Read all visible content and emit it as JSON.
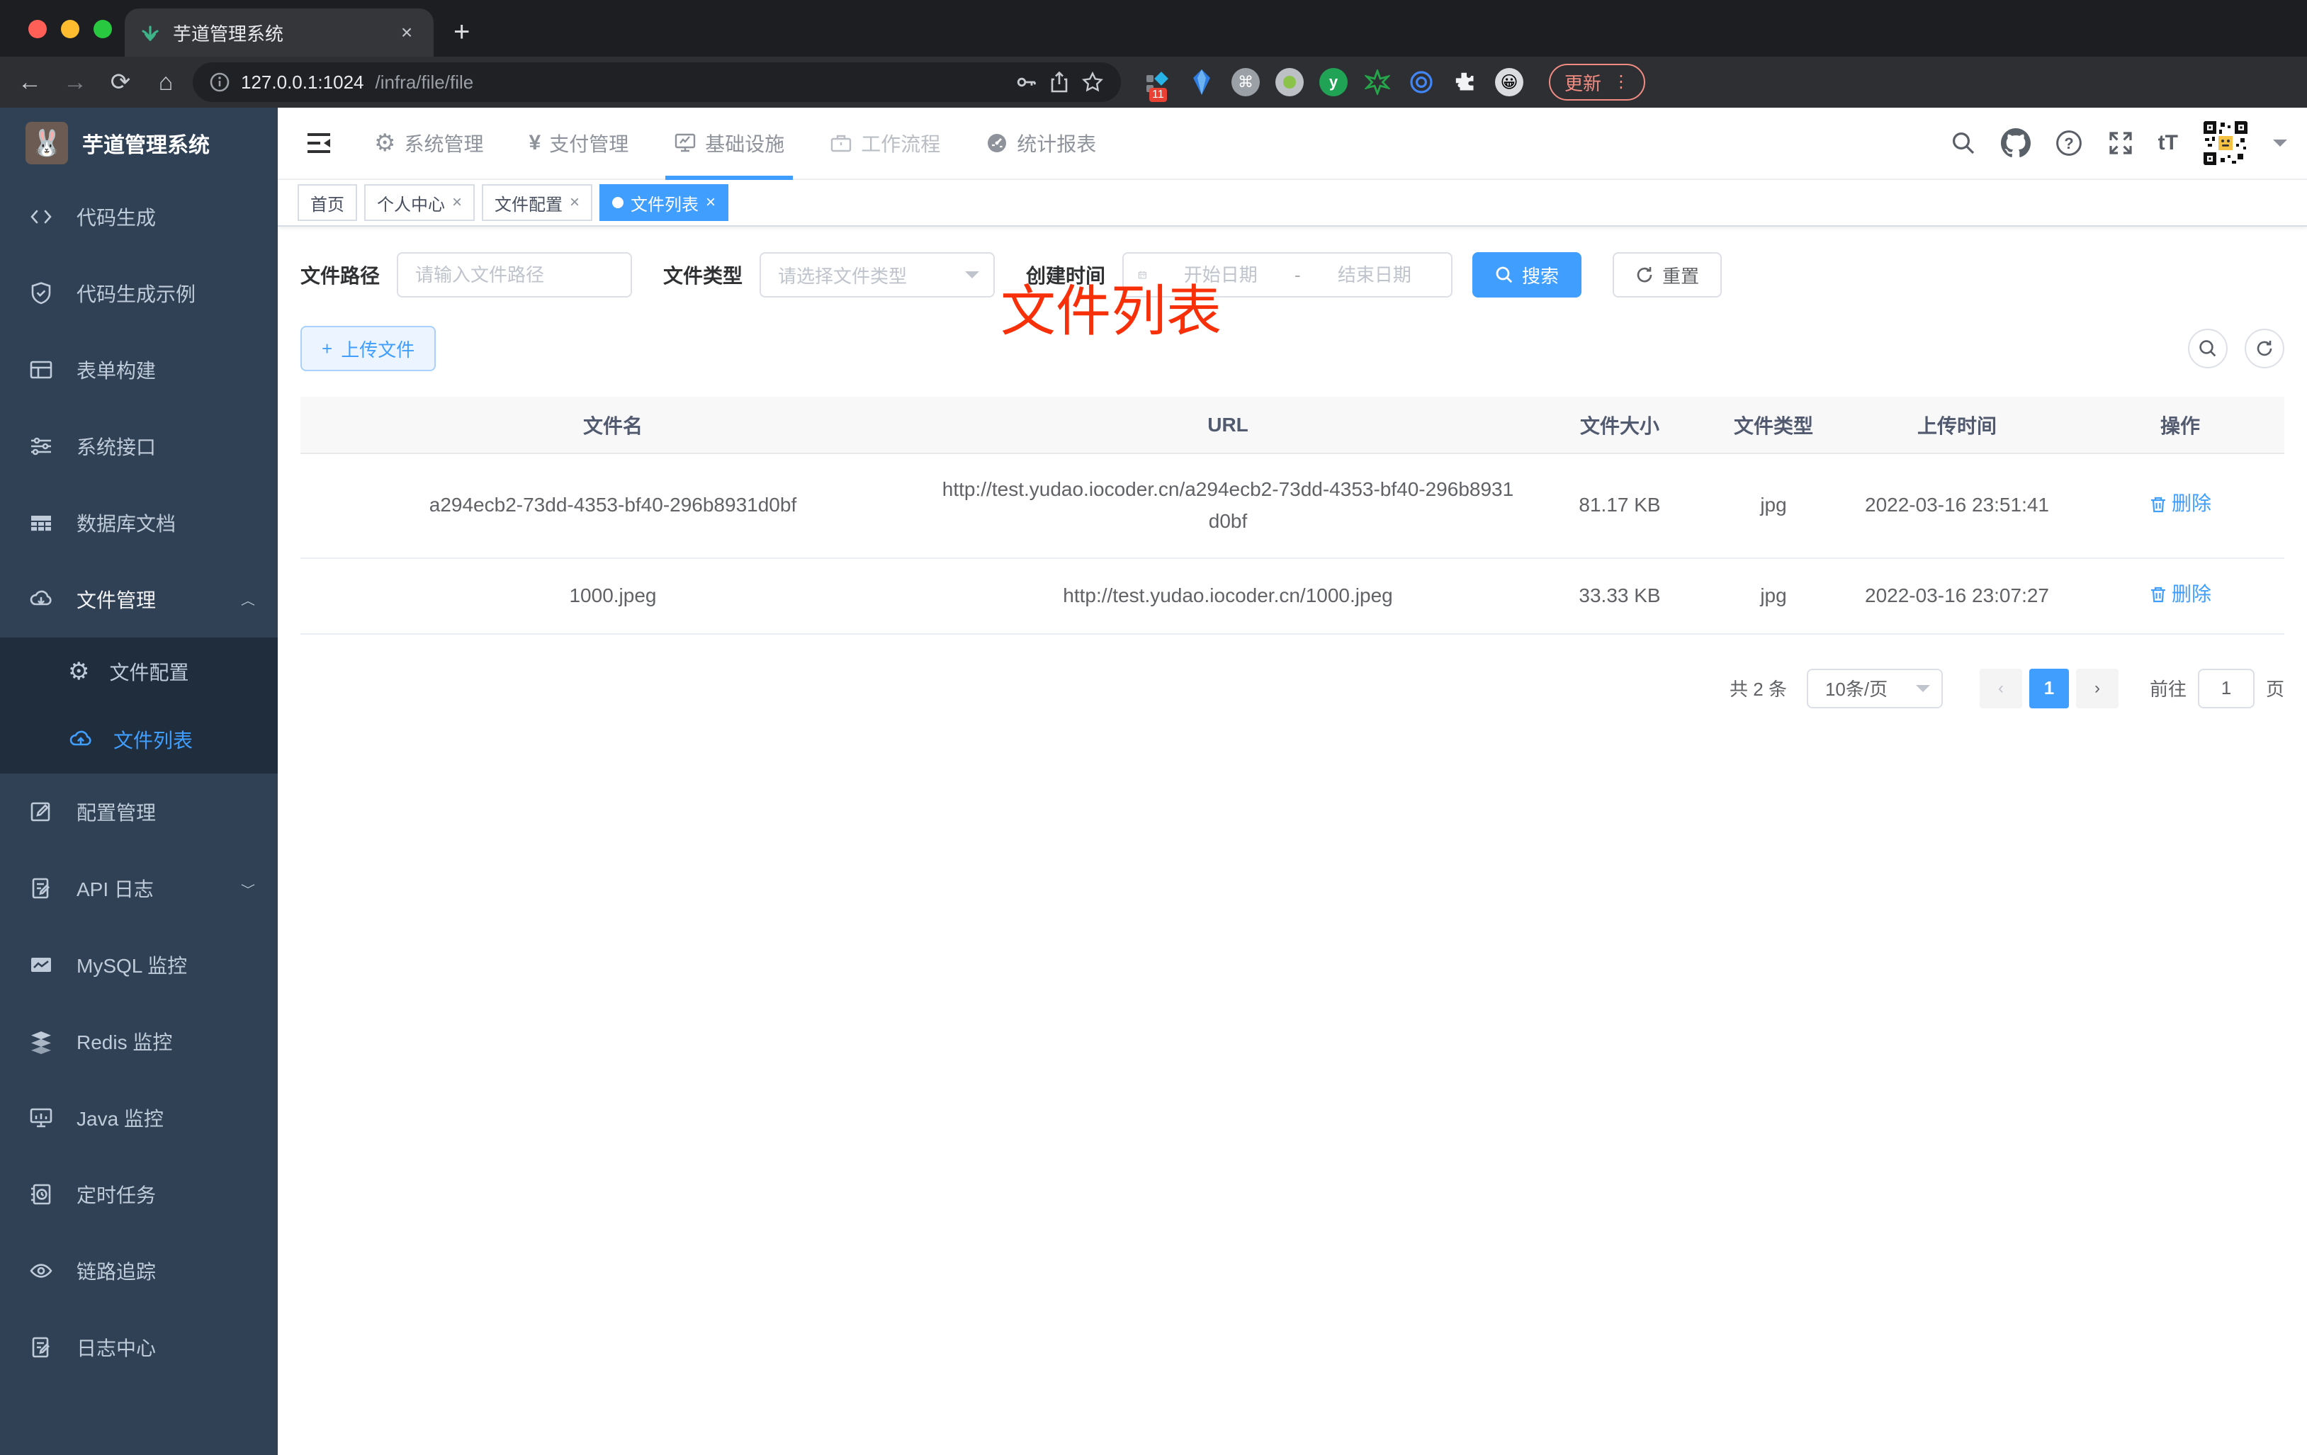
{
  "browser": {
    "tab_title": "芋道管理系统",
    "url_host": "127.0.0.1:1024",
    "url_path": "/infra/file/file",
    "extension_badge": "11",
    "update_label": "更新"
  },
  "glyphs": {
    "close_x": "×",
    "new_tab_plus": "+",
    "cmd": "⌘",
    "y_letter": "y",
    "smiley": "😀",
    "yen": "¥",
    "gear": "⚙",
    "tT": "tT",
    "kebab": "⋮"
  },
  "app": {
    "logo_title": "芋道管理系统",
    "top_nav": [
      {
        "label": "系统管理"
      },
      {
        "label": "支付管理"
      },
      {
        "label": "基础设施",
        "active": true
      },
      {
        "label": "工作流程"
      },
      {
        "label": "统计报表"
      }
    ],
    "sidebar": [
      {
        "label": "代码生成"
      },
      {
        "label": "代码生成示例"
      },
      {
        "label": "表单构建"
      },
      {
        "label": "系统接口"
      },
      {
        "label": "数据库文档"
      },
      {
        "label": "文件管理",
        "expanded": true,
        "children": [
          {
            "label": "文件配置"
          },
          {
            "label": "文件列表",
            "active": true
          }
        ]
      },
      {
        "label": "配置管理"
      },
      {
        "label": "API 日志",
        "collapsible": true
      },
      {
        "label": "MySQL 监控"
      },
      {
        "label": "Redis 监控"
      },
      {
        "label": "Java 监控"
      },
      {
        "label": "定时任务"
      },
      {
        "label": "链路追踪"
      },
      {
        "label": "日志中心"
      }
    ]
  },
  "tags": [
    {
      "label": "首页",
      "closable": false
    },
    {
      "label": "个人中心",
      "closable": true
    },
    {
      "label": "文件配置",
      "closable": true
    },
    {
      "label": "文件列表",
      "closable": true,
      "active": true
    }
  ],
  "annotation": {
    "text": "文件列表"
  },
  "filters": {
    "path_label": "文件路径",
    "path_placeholder": "请输入文件路径",
    "type_label": "文件类型",
    "type_placeholder": "请选择文件类型",
    "time_label": "创建时间",
    "start_placeholder": "开始日期",
    "range_separator": "-",
    "end_placeholder": "结束日期",
    "search_label": "搜索",
    "reset_label": "重置"
  },
  "toolbar": {
    "upload_label": "上传文件",
    "upload_plus": "+"
  },
  "table": {
    "headers": [
      "文件名",
      "URL",
      "文件大小",
      "文件类型",
      "上传时间",
      "操作"
    ],
    "rows": [
      {
        "name": "a294ecb2-73dd-4353-bf40-296b8931d0bf",
        "url": "http://test.yudao.iocoder.cn/a294ecb2-73dd-4353-bf40-296b8931d0bf",
        "size": "81.17 KB",
        "type": "jpg",
        "time": "2022-03-16 23:51:41",
        "action": "删除"
      },
      {
        "name": "1000.jpeg",
        "url": "http://test.yudao.iocoder.cn/1000.jpeg",
        "size": "33.33 KB",
        "type": "jpg",
        "time": "2022-03-16 23:07:27",
        "action": "删除"
      }
    ]
  },
  "pagination": {
    "total": "共 2 条",
    "page_size": "10条/页",
    "prev": "‹",
    "current": "1",
    "next": "›",
    "goto_label": "前往",
    "goto_value": "1",
    "page_suffix": "页"
  },
  "colors": {
    "accent": "#409eff",
    "annotation_red": "#f8300a",
    "sidebar_bg": "#304156",
    "submenu_bg": "#1f2d3d",
    "chrome_bg": "#1d1e21"
  }
}
